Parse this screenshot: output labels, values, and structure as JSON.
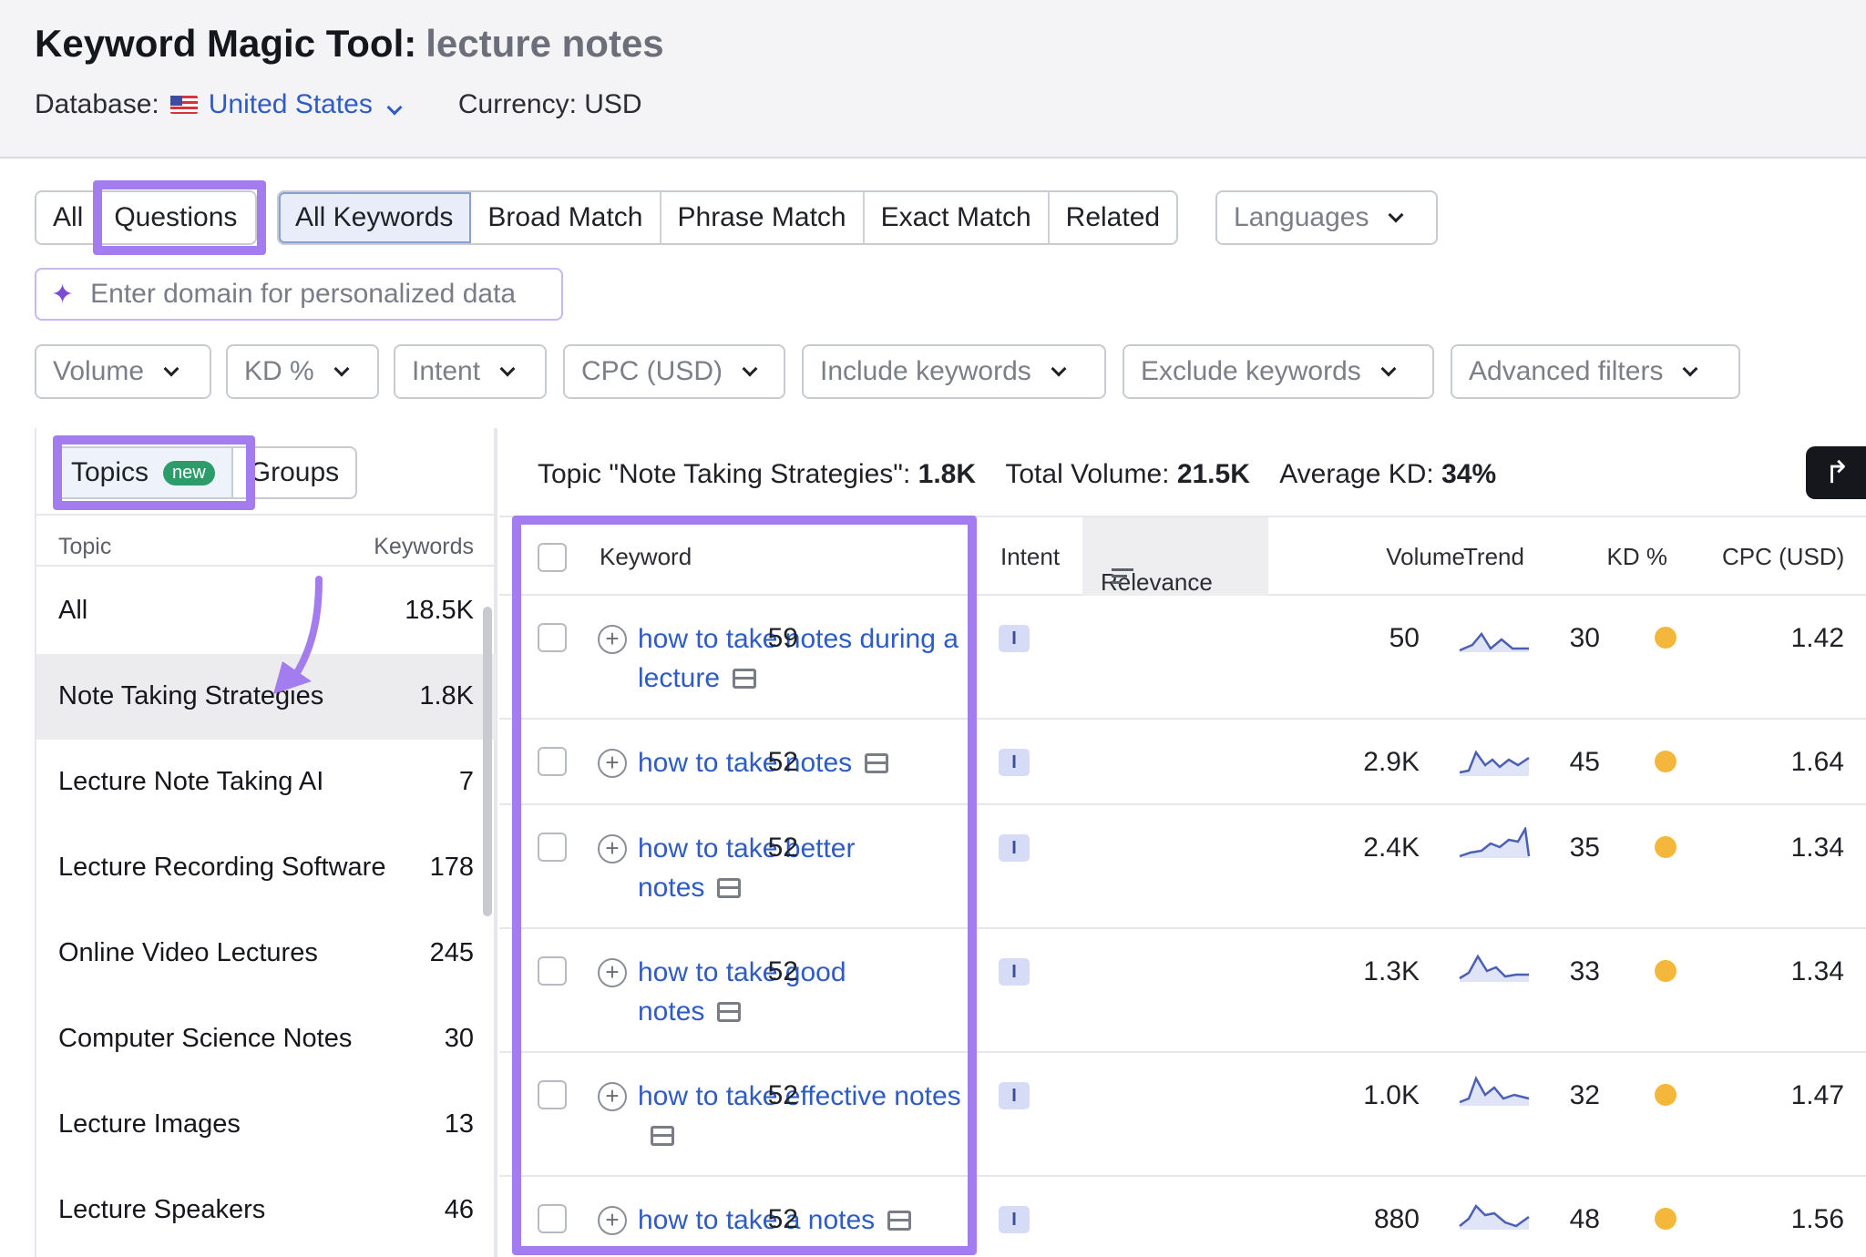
{
  "header": {
    "title": "Keyword Magic Tool:",
    "query": "lecture notes",
    "database_label": "Database:",
    "database_value": "United States",
    "currency": "Currency: USD"
  },
  "match_tabs": {
    "scope": [
      "All",
      "Questions"
    ],
    "types": [
      "All Keywords",
      "Broad Match",
      "Phrase Match",
      "Exact Match",
      "Related"
    ],
    "languages": "Languages"
  },
  "domain_input": {
    "placeholder": "Enter domain for personalized data"
  },
  "filters": [
    "Volume",
    "KD %",
    "Intent",
    "CPC (USD)",
    "Include keywords",
    "Exclude keywords",
    "Advanced filters"
  ],
  "left_panel": {
    "tabs": {
      "topics": "Topics",
      "badge": "new",
      "groups": "Groups"
    },
    "header": {
      "topic": "Topic",
      "keywords": "Keywords"
    },
    "topics": [
      {
        "name": "All",
        "count": "18.5K"
      },
      {
        "name": "Note Taking Strategies",
        "count": "1.8K"
      },
      {
        "name": "Lecture Note Taking AI",
        "count": "7"
      },
      {
        "name": "Lecture Recording Software",
        "count": "178"
      },
      {
        "name": "Online Video Lectures",
        "count": "245"
      },
      {
        "name": "Computer Science Notes",
        "count": "30"
      },
      {
        "name": "Lecture Images",
        "count": "13"
      },
      {
        "name": "Lecture Speakers",
        "count": "46"
      }
    ]
  },
  "summary": {
    "topic_label": "Topic \"Note Taking Strategies\":",
    "topic_value": "1.8K",
    "total_label": "Total Volume:",
    "total_value": "21.5K",
    "kd_label": "Average KD:",
    "kd_value": "34%"
  },
  "table": {
    "headers": {
      "keyword": "Keyword",
      "intent": "Intent",
      "relevance": "Relevance",
      "volume": "Volume",
      "trend": "Trend",
      "kd": "KD %",
      "cpc": "CPC (USD)"
    },
    "rows": [
      {
        "keyword": "how to take notes during a lecture",
        "intent": "I",
        "relevance": "59",
        "volume": "50",
        "kd": "30",
        "cpc": "1.42"
      },
      {
        "keyword": "how to take notes",
        "intent": "I",
        "relevance": "52",
        "volume": "2.9K",
        "kd": "45",
        "cpc": "1.64"
      },
      {
        "keyword": "how to take better notes",
        "intent": "I",
        "relevance": "52",
        "volume": "2.4K",
        "kd": "35",
        "cpc": "1.34"
      },
      {
        "keyword": "how to take good notes",
        "intent": "I",
        "relevance": "52",
        "volume": "1.3K",
        "kd": "33",
        "cpc": "1.34"
      },
      {
        "keyword": "how to take effective notes",
        "intent": "I",
        "relevance": "52",
        "volume": "1.0K",
        "kd": "32",
        "cpc": "1.47"
      },
      {
        "keyword": "how to take a notes",
        "intent": "I",
        "relevance": "52",
        "volume": "880",
        "kd": "48",
        "cpc": "1.56"
      }
    ]
  },
  "colors": {
    "highlight": "#a37df0",
    "link": "#2e5bc4",
    "kd_dot": "#f4b73c",
    "badge": "#2b9c6a"
  }
}
